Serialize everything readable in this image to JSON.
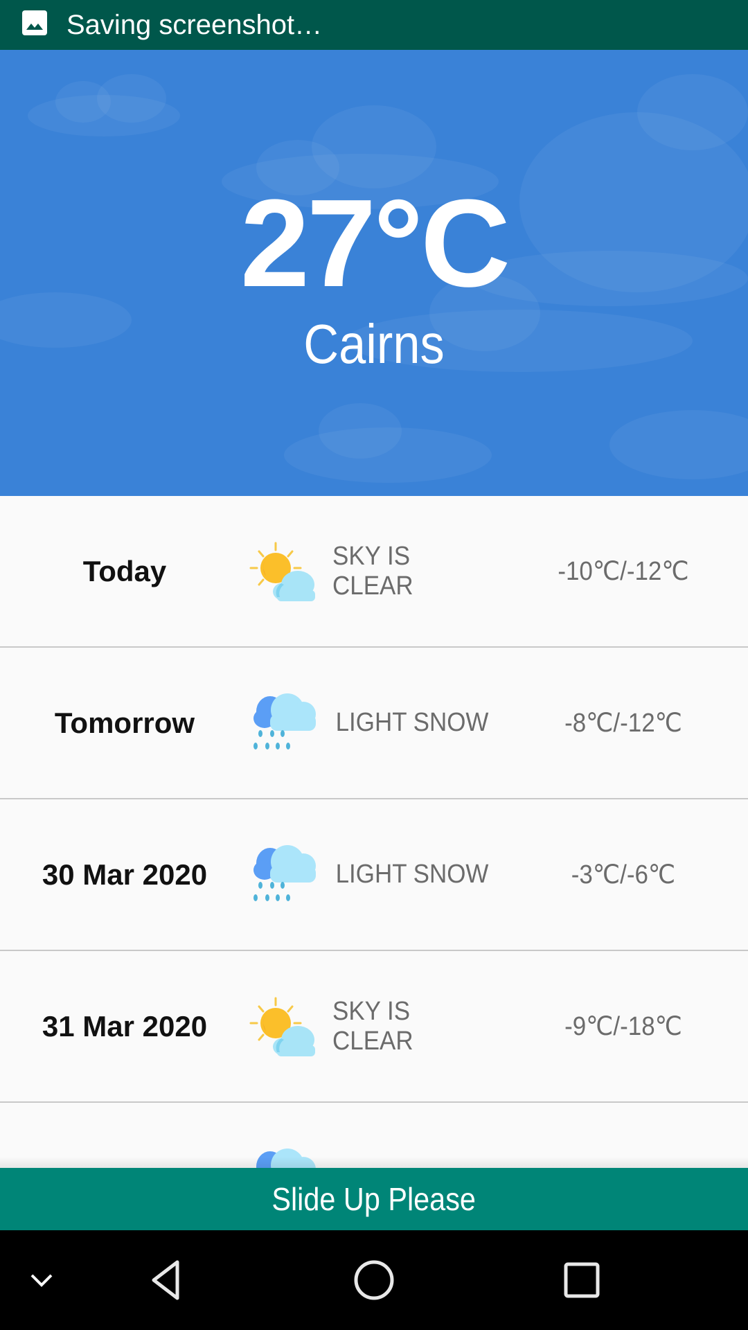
{
  "status_bar": {
    "icon": "image-icon",
    "text": "Saving screenshot…",
    "background": "#00574b"
  },
  "hero": {
    "temperature": "27°C",
    "city": "Cairns",
    "background": "#3a82d7"
  },
  "forecast": [
    {
      "day": "Today",
      "icon": "sun-cloud-icon",
      "description": "SKY IS CLEAR",
      "range": "-10℃/-12℃"
    },
    {
      "day": "Tomorrow",
      "icon": "rain-cloud-icon",
      "description": "LIGHT SNOW",
      "range": "-8℃/-12℃"
    },
    {
      "day": "30 Mar 2020",
      "icon": "rain-cloud-icon",
      "description": "LIGHT SNOW",
      "range": "-3℃/-6℃"
    },
    {
      "day": "31 Mar 2020",
      "icon": "sun-cloud-icon",
      "description": "SKY IS CLEAR",
      "range": "-9℃/-18℃"
    },
    {
      "day": "",
      "icon": "rain-cloud-icon",
      "description": "",
      "range": ""
    }
  ],
  "slide_bar": {
    "label": "Slide Up Please",
    "background": "#008577"
  },
  "nav_bar": {
    "buttons": [
      "collapse-icon",
      "back-icon",
      "home-icon",
      "recents-icon"
    ]
  }
}
